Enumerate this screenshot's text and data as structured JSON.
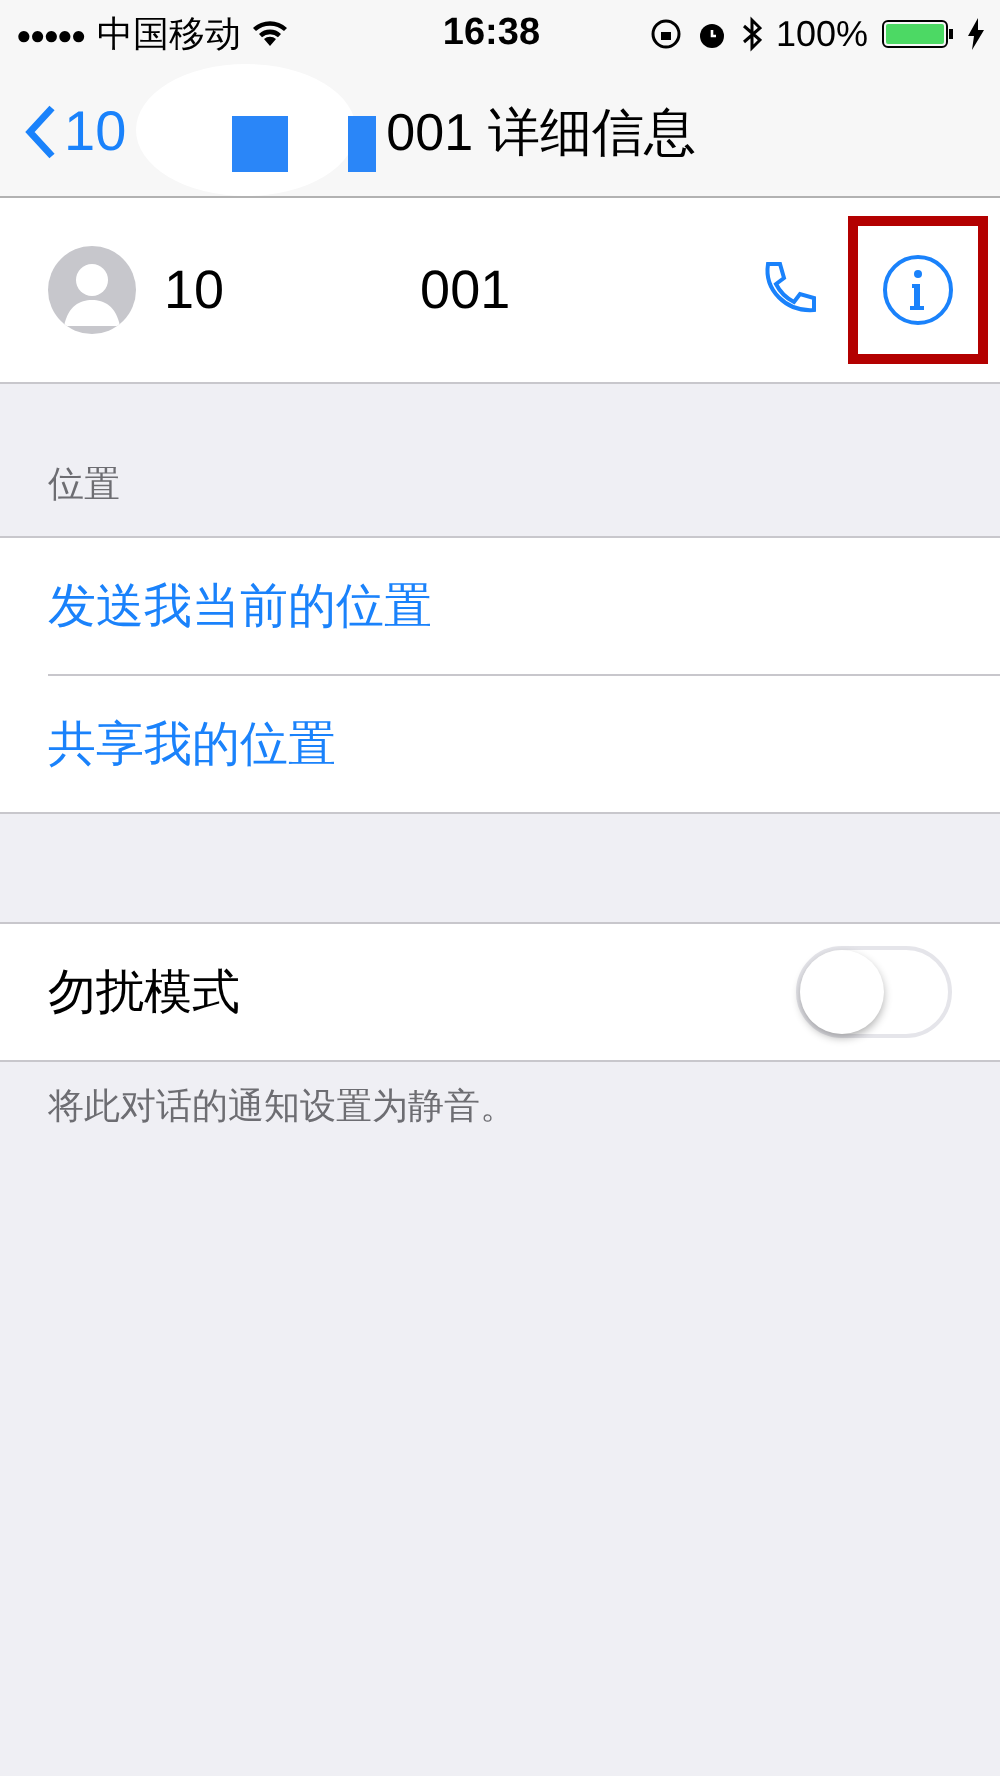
{
  "status_bar": {
    "signal_dots": "●●●●●",
    "carrier": "中国移动",
    "time": "16:38",
    "battery": "100%"
  },
  "nav": {
    "back_label": "10",
    "title": "001 详细信息"
  },
  "contact": {
    "name_start": "10",
    "name_end": "001",
    "highlight_info": true
  },
  "location": {
    "header": "位置",
    "actions": [
      "发送我当前的位置",
      "共享我的位置"
    ]
  },
  "dnd": {
    "label": "勿扰模式",
    "on": false,
    "footer": "将此对话的通知设置为静音。"
  }
}
